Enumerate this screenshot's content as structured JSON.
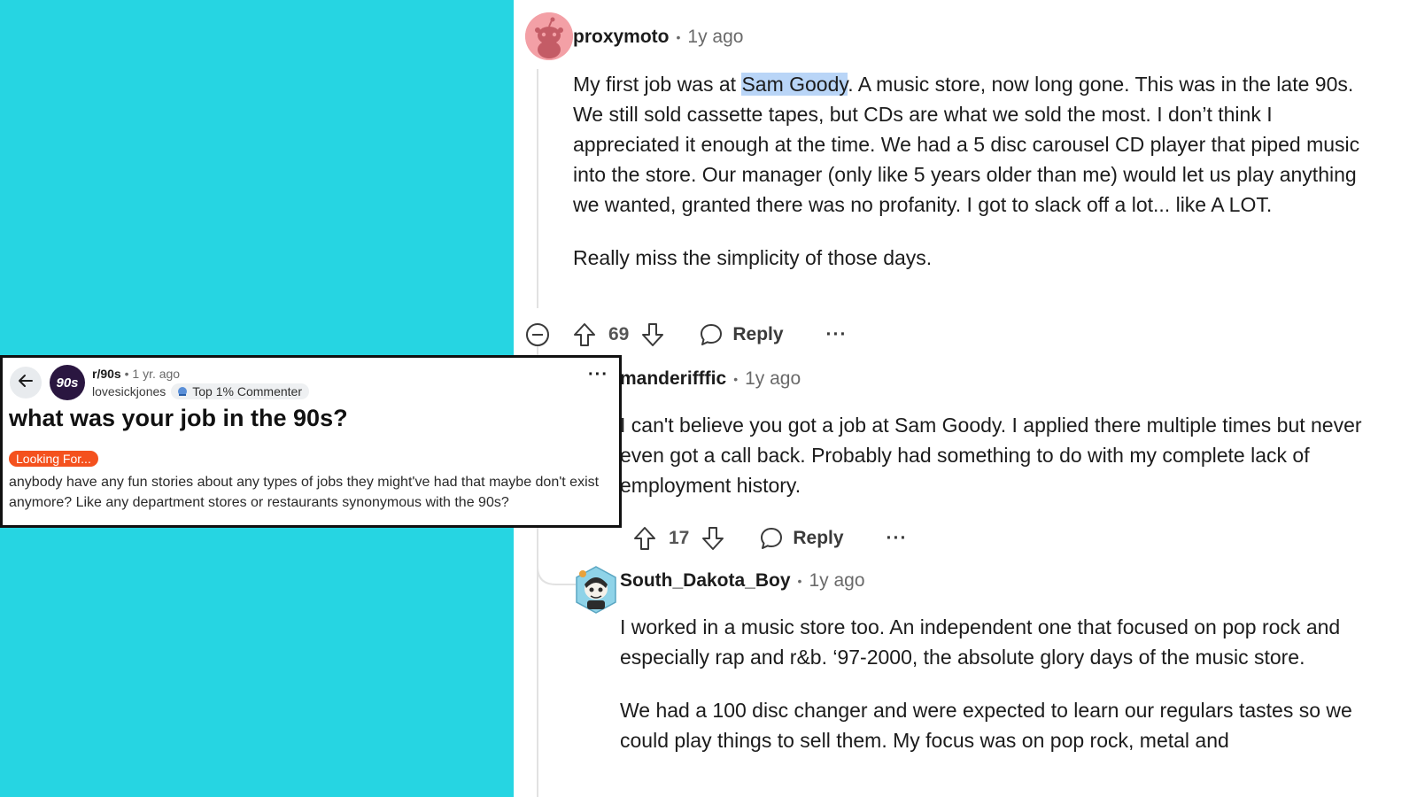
{
  "thread": {
    "comments": [
      {
        "user": "proxymoto",
        "time": "1y ago",
        "body_parts": {
          "before": "My first job was at ",
          "highlight": "Sam Goody",
          "after": ". A music store, now long gone. This was in the late 90s. We still sold cassette tapes, but CDs are what we sold the most. I don’t think I appreciated it enough at the time. We had a 5 disc carousel CD player that piped music into the store. Our manager (only like 5 years older than me) would let us play anything we wanted, granted there was no profanity. I got to slack off a lot... like A LOT."
        },
        "paragraph2": "Really miss the simplicity of those days.",
        "votes": "69",
        "reply_label": "Reply",
        "more": "···"
      },
      {
        "user": "manderifffic",
        "time": "1y ago",
        "body": "I can't believe you got a job at Sam Goody. I applied there multiple times but never even got a call back. Probably had something to do with my complete lack of employment history.",
        "votes": "17",
        "reply_label": "Reply",
        "more": "···"
      },
      {
        "user": "South_Dakota_Boy",
        "time": "1y ago",
        "body": "I worked in a music store too. An independent one that focused on pop rock and especially rap and r&b. ‘97-2000, the absolute glory days of the music store.",
        "paragraph2": "We had a 100 disc changer and were expected to learn our regulars tastes so we could play things to sell them. My focus was on pop rock, metal and"
      }
    ],
    "separator": "•"
  },
  "post": {
    "subreddit": "r/90s",
    "time": "1 yr. ago",
    "author": "lovesickjones",
    "badge": "Top 1% Commenter",
    "title": "what was your job in the 90s?",
    "flair": "Looking For...",
    "body": "anybody have any fun stories about any types of jobs they might've had that maybe don't exist anymore? Like any department stores or restaurants synonymous with the 90s?",
    "sub_avatar_text": "90s",
    "more": "···"
  },
  "colors": {
    "background": "#26d5e2",
    "highlight": "#b9d5f7",
    "flair": "#f4511e"
  },
  "icons": [
    "back-arrow-icon",
    "upvote-icon",
    "downvote-icon",
    "comment-icon",
    "collapse-icon",
    "more-icon",
    "badge-icon"
  ]
}
